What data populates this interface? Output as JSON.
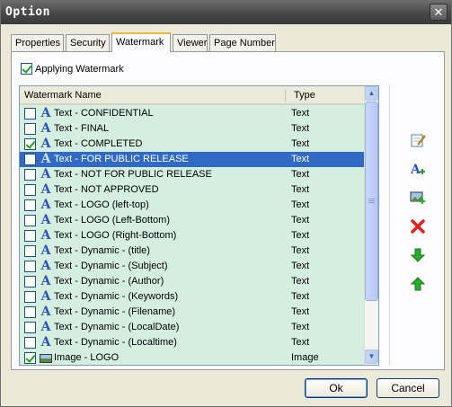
{
  "window": {
    "title": "Option",
    "close_glyph": "✕"
  },
  "tabs": [
    {
      "label": "Properties",
      "active": false
    },
    {
      "label": "Security",
      "active": false
    },
    {
      "label": "Watermark",
      "active": true
    },
    {
      "label": "Viewer",
      "active": false
    },
    {
      "label": "Page Number",
      "active": false
    }
  ],
  "apply_watermark": {
    "label": "Applying Watermark",
    "checked": true
  },
  "list": {
    "headers": {
      "name": "Watermark Name",
      "type": "Type"
    },
    "rows": [
      {
        "name": "Text - CONFIDENTIAL",
        "type": "Text",
        "checked": false,
        "icon": "text-icon",
        "selected": false
      },
      {
        "name": "Text - FINAL",
        "type": "Text",
        "checked": false,
        "icon": "text-icon",
        "selected": false
      },
      {
        "name": "Text - COMPLETED",
        "type": "Text",
        "checked": true,
        "icon": "text-icon",
        "selected": false
      },
      {
        "name": "Text - FOR PUBLIC RELEASE",
        "type": "Text",
        "checked": false,
        "icon": "text-icon",
        "selected": true
      },
      {
        "name": "Text - NOT FOR PUBLIC RELEASE",
        "type": "Text",
        "checked": false,
        "icon": "text-icon",
        "selected": false
      },
      {
        "name": "Text - NOT APPROVED",
        "type": "Text",
        "checked": false,
        "icon": "text-icon",
        "selected": false
      },
      {
        "name": "Text - LOGO (left-top)",
        "type": "Text",
        "checked": false,
        "icon": "text-icon",
        "selected": false
      },
      {
        "name": "Text - LOGO (Left-Bottom)",
        "type": "Text",
        "checked": false,
        "icon": "text-icon",
        "selected": false
      },
      {
        "name": "Text - LOGO (Right-Bottom)",
        "type": "Text",
        "checked": false,
        "icon": "text-icon",
        "selected": false
      },
      {
        "name": "Text - Dynamic - (title)",
        "type": "Text",
        "checked": false,
        "icon": "text-icon",
        "selected": false
      },
      {
        "name": "Text - Dynamic - (Subject)",
        "type": "Text",
        "checked": false,
        "icon": "text-icon",
        "selected": false
      },
      {
        "name": "Text - Dynamic - (Author)",
        "type": "Text",
        "checked": false,
        "icon": "text-icon",
        "selected": false
      },
      {
        "name": "Text - Dynamic - (Keywords)",
        "type": "Text",
        "checked": false,
        "icon": "text-icon",
        "selected": false
      },
      {
        "name": "Text - Dynamic - (Filename)",
        "type": "Text",
        "checked": false,
        "icon": "text-icon",
        "selected": false
      },
      {
        "name": "Text - Dynamic - (LocalDate)",
        "type": "Text",
        "checked": false,
        "icon": "text-icon",
        "selected": false
      },
      {
        "name": "Text - Dynamic - (Localtime)",
        "type": "Text",
        "checked": false,
        "icon": "text-icon",
        "selected": false
      },
      {
        "name": "Image - LOGO",
        "type": "Image",
        "checked": true,
        "icon": "image-icon",
        "selected": false
      }
    ]
  },
  "toolbar": {
    "items": [
      {
        "name": "edit-watermark-icon"
      },
      {
        "name": "add-text-watermark-icon"
      },
      {
        "name": "add-image-watermark-icon"
      },
      {
        "name": "delete-watermark-icon"
      },
      {
        "name": "move-down-icon"
      },
      {
        "name": "move-up-icon"
      }
    ]
  },
  "buttons": {
    "ok": "Ok",
    "cancel": "Cancel"
  },
  "colors": {
    "list_background": "#d4efe0",
    "selection": "#316ac5",
    "tab_active_accent": "#f4b33a",
    "delete_red": "#e01f1f",
    "arrow_green": "#2ca82c"
  }
}
